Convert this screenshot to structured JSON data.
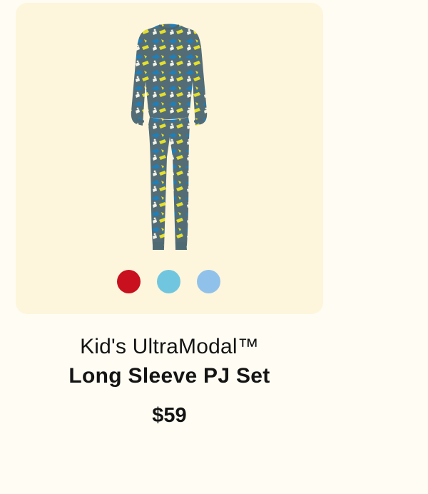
{
  "product": {
    "collection": "Kid's UltraModal™",
    "name": "Long Sleeve PJ Set",
    "price": "$59",
    "image_icon": "pajama-set-icon",
    "colors": {
      "panel_bg": "#fdf6dc",
      "page_bg": "#fffdf3",
      "fabric_base": "#4f6b78",
      "pattern_blue": "#1f7fb8",
      "pattern_yellow": "#e6df2a"
    },
    "swatches": [
      {
        "name": "red",
        "color": "#c8101e"
      },
      {
        "name": "light-blue",
        "color": "#71c6df"
      },
      {
        "name": "sky-blue",
        "color": "#90c1ea"
      }
    ]
  }
}
